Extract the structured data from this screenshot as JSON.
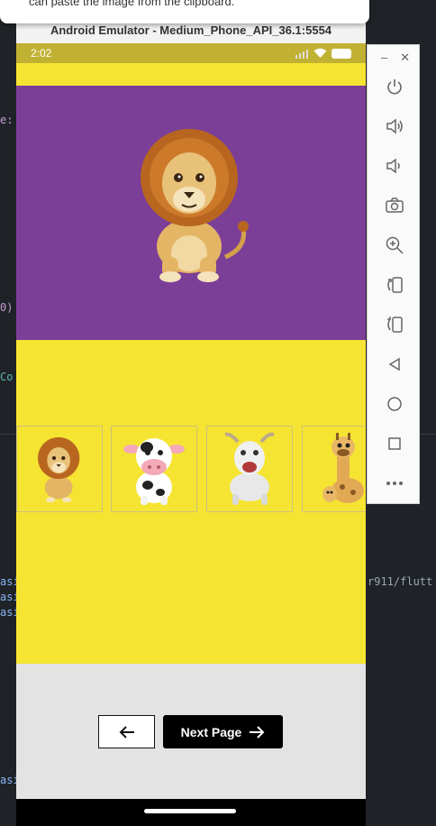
{
  "toast": {
    "text": "can paste the image from the clipboard."
  },
  "editor": {
    "fragment_1": "e:",
    "fragment_2": "0)",
    "fragment_3": "Co",
    "fragment_4": "asi",
    "fragment_5": "asi",
    "fragment_6": "asi",
    "fragment_7": "r911/flutt",
    "fragment_8": "asi"
  },
  "emulator": {
    "title": "Android Emulator - Medium_Phone_API_36.1:5554",
    "status_time": "2:02"
  },
  "app": {
    "hero_image": "lion",
    "thumbnails": [
      {
        "name": "lion"
      },
      {
        "name": "cow"
      },
      {
        "name": "goat"
      },
      {
        "name": "giraffe"
      }
    ],
    "back_button_icon": "arrow-left-icon",
    "next_button_label": "Next Page"
  },
  "toolbar": {
    "buttons": [
      "power-icon",
      "volume-up-icon",
      "volume-down-icon",
      "camera-icon",
      "zoom-icon",
      "rotate-left-icon",
      "rotate-right-icon",
      "back-icon",
      "home-icon",
      "overview-icon",
      "more-icon"
    ]
  },
  "colors": {
    "purple": "#7b3f98",
    "yellow": "#f5e432",
    "status_bar": "#c1b132"
  }
}
